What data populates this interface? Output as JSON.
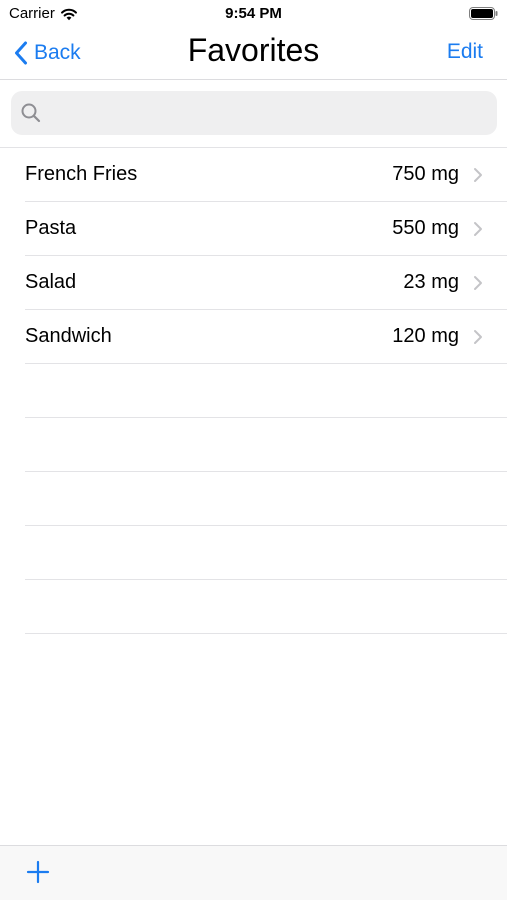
{
  "status_bar": {
    "carrier": "Carrier",
    "time": "9:54 PM",
    "icons": [
      "wifi-icon",
      "battery-icon"
    ]
  },
  "nav": {
    "back_label": "Back",
    "title": "Favorites",
    "edit_label": "Edit"
  },
  "search": {
    "value": "",
    "placeholder": ""
  },
  "favorites": [
    {
      "name": "French Fries",
      "value": "750 mg"
    },
    {
      "name": "Pasta",
      "value": "550 mg"
    },
    {
      "name": "Salad",
      "value": "23 mg"
    },
    {
      "name": "Sandwich",
      "value": "120 mg"
    }
  ],
  "toolbar": {
    "add_icon": "plus-icon"
  },
  "colors": {
    "accent": "#1b7cf0",
    "separator": "#e3e3e6",
    "search_bg": "#efeff0",
    "chevron": "#c4c4c7"
  }
}
